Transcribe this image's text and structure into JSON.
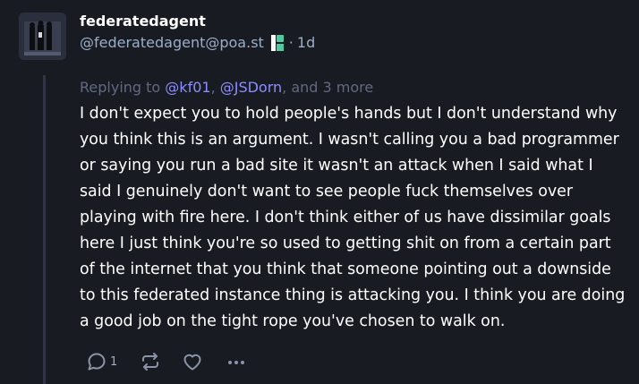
{
  "status": {
    "display_name": "federatedagent",
    "acct": "@federatedagent@poa.st",
    "separator": "·",
    "time_ago": "1d",
    "app_icon": "pleroma-app-icon",
    "replying": {
      "prefix": "Replying to ",
      "mention1": "@kf01",
      "comma1": ", ",
      "mention2": "@JSDorn",
      "suffix": ", and 3 more"
    },
    "content": "I don't expect you to hold people's hands but I don't understand why you think this is an argument. I wasn't calling you a bad programmer or saying you run a bad site it wasn't an attack when I said what I said I genuinely don't want to see people fuck themselves over playing with fire here. I don't think either of us have dissimilar goals here I just think you're so used to getting shit on from a certain part of the internet that you think that someone pointing out a downside to this federated instance thing is attacking you. I think you are doing a good job on the tight rope you've chosen to walk on.",
    "actions": {
      "reply_count": "1",
      "reply_icon": "reply-icon",
      "boost_icon": "boost-icon",
      "favourite_icon": "heart-icon",
      "more_icon": "ellipsis-icon"
    }
  },
  "colors": {
    "background": "#191b22",
    "secondary_text": "#9baec8",
    "mention": "#8c8dff",
    "muted": "#606984"
  }
}
